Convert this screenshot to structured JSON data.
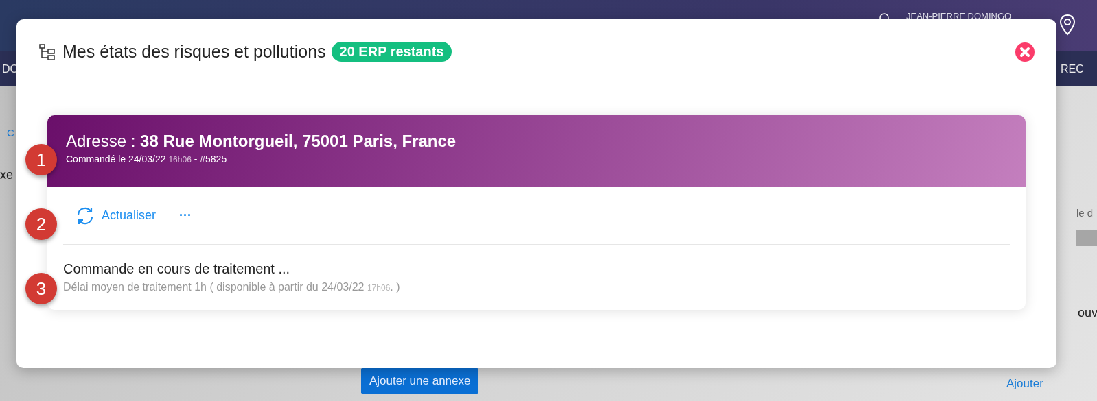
{
  "background": {
    "user_name": "JEAN-PIERRE DOMINGO",
    "nav_left": "DO",
    "nav_right": "REC",
    "side_left": "C",
    "section_left": "xe",
    "side_right": "le d",
    "section_right": "ouv",
    "add_button": "Ajouter une annexe",
    "add_link": "Ajouter"
  },
  "modal": {
    "title": "Mes états des risques et pollutions",
    "badge": "20 ERP restants"
  },
  "order": {
    "address_label": "Adresse :",
    "address": "38 Rue Montorgueil, 75001 Paris, France",
    "ordered": "Commandé le 24/03/22",
    "ordered_time": "16h06",
    "reference": "- #5825"
  },
  "steps": [
    "1",
    "2",
    "3"
  ],
  "actions": {
    "refresh": "Actualiser",
    "more": "···"
  },
  "status": {
    "title": "Commande en cours de traitement ...",
    "detail": "Délai moyen de traitement 1h ( disponible à partir du 24/03/22",
    "detail_time": "17h06",
    "detail_end": ". )"
  }
}
